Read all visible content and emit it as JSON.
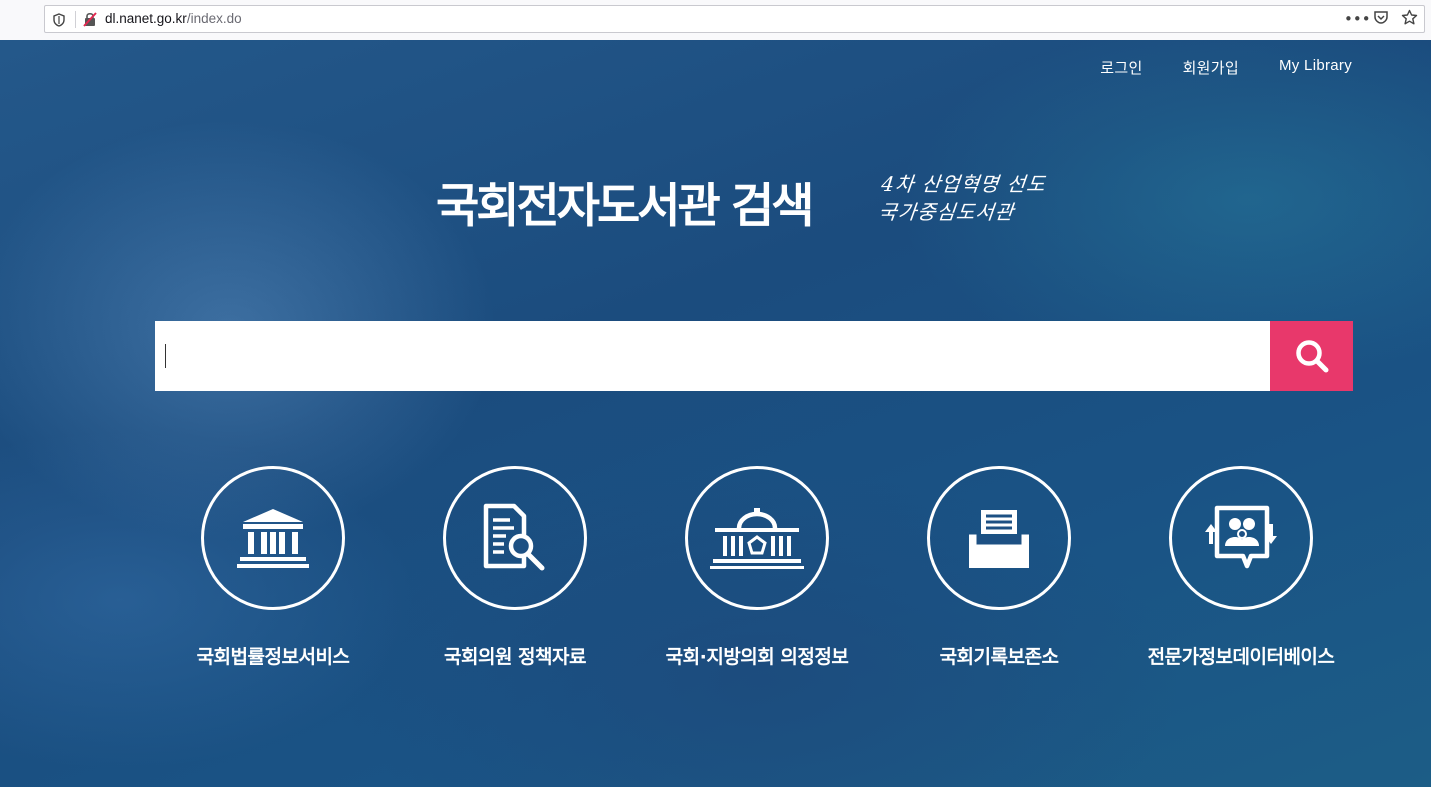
{
  "browser": {
    "url_host": "dl.nanet.go.kr",
    "url_path": "/index.do"
  },
  "nav": {
    "login": "로그인",
    "signup": "회원가입",
    "my_library": "My Library"
  },
  "hero": {
    "title": "국회전자도서관 검색",
    "slogan_line1": "4차 산업혁명 선도",
    "slogan_line2": "국가중심도서관"
  },
  "search": {
    "value": "",
    "placeholder": "",
    "button_icon": "search-icon",
    "button_color": "#e8386b"
  },
  "services": [
    {
      "label": "국회법률정보서비스",
      "icon": "courthouse-icon"
    },
    {
      "label": "국회의원 정책자료",
      "icon": "document-search-icon"
    },
    {
      "label": "국회·지방의회 의정정보",
      "icon": "assembly-building-icon"
    },
    {
      "label": "국회기록보존소",
      "icon": "archive-box-icon"
    },
    {
      "label": "전문가정보데이터베이스",
      "icon": "expert-people-icon"
    }
  ]
}
